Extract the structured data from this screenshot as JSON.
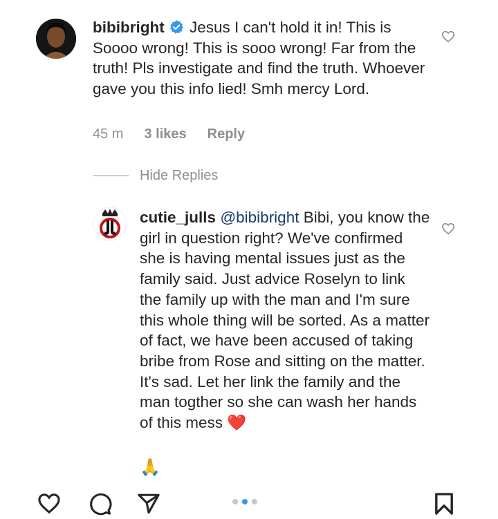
{
  "comments": [
    {
      "username": "bibibright",
      "verified": true,
      "text": "Jesus I can't hold it in!  This is Soooo wrong! This is sooo wrong! Far from the truth! Pls investigate and find the truth. Whoever gave you this info lied! Smh mercy Lord.",
      "time": "45 m",
      "likes": "3 likes",
      "reply_label": "Reply"
    },
    {
      "username": "cutie_julls",
      "mention": "@bibibright",
      "text": "Bibi, you know the girl in question right? We've confirmed she is having mental issues just as the family said. Just advice Roselyn to link the family up with the man and I'm sure this whole thing will be sorted. As a matter of fact, we have been accused of taking bribe from Rose and sitting on the matter. It's sad. Let her link the family and the man togther so she can wash her hands of this mess",
      "emoji_heart": "❤️",
      "emoji_pray": "🙏"
    }
  ],
  "hide_replies_label": "Hide Replies",
  "icons": {
    "like": "heart-outline-icon",
    "comment": "comment-icon",
    "share": "send-icon",
    "save": "bookmark-icon",
    "verified": "verified-badge-icon"
  },
  "carousel": {
    "count": 3,
    "active_index": 1
  },
  "colors": {
    "accent": "#3897f0",
    "verified": "#3897f0",
    "muted": "#8e8e8e"
  }
}
